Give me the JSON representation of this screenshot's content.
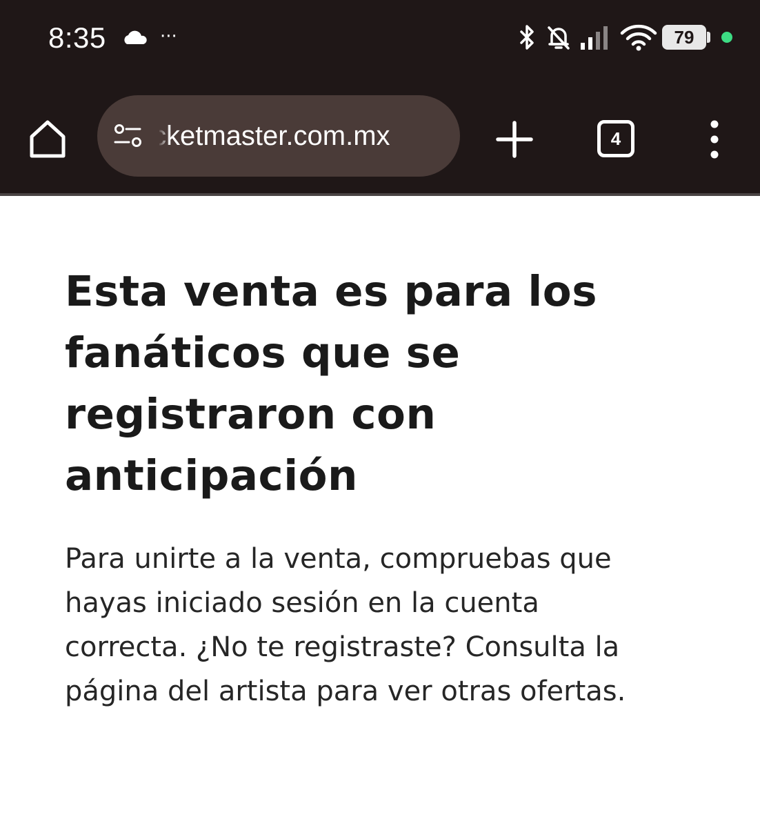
{
  "status_bar": {
    "time": "8:35",
    "more_indicator": "···",
    "battery_level": "79",
    "icons": [
      "cloud-icon",
      "bluetooth-icon",
      "notifications-off-icon",
      "cellular-signal-icon",
      "wifi-icon",
      "battery-icon",
      "active-indicator-dot"
    ]
  },
  "browser": {
    "url": "ticketmaster.com.mx",
    "tab_count": "4",
    "icons": [
      "home-icon",
      "site-settings-icon",
      "plus-icon",
      "tabs-icon",
      "more-vert-icon"
    ]
  },
  "page": {
    "headline_lines": [
      "Esta venta es para los",
      "fanáticos que se",
      "registraron con",
      "anticipación"
    ],
    "body_lines": [
      "Para unirte a la venta, compruebas que",
      "hayas iniciado sesión en la cuenta",
      "correcta. ¿No te registraste? Consulta la",
      "página del artista para ver otras ofertas."
    ]
  },
  "colors": {
    "chrome_background": "#1f1717",
    "url_bar_background": "#4a3b38",
    "page_background": "#ffffff",
    "text": "#1a1a1a",
    "status_dot": "#3ddc84"
  }
}
